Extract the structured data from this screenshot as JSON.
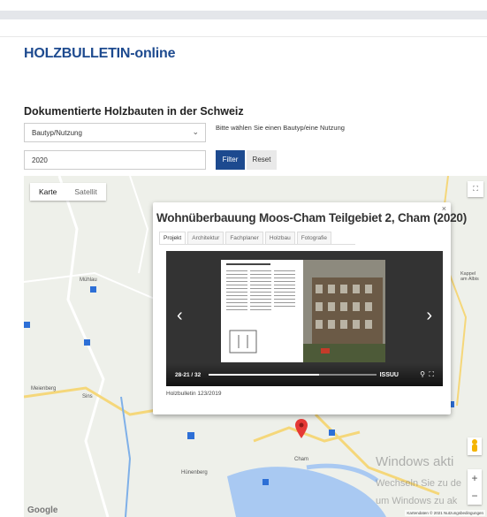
{
  "site": {
    "title": "HOLZBULLETIN-online"
  },
  "section": {
    "title": "Dokumentierte Holzbauten in der Schweiz"
  },
  "filters": {
    "type_select": {
      "value": "Bautyp/Nutzung"
    },
    "hint": "Bitte wählen Sie einen Bautyp/eine Nutzung",
    "year": {
      "value": "2020"
    },
    "filter_label": "Filter",
    "reset_label": "Reset"
  },
  "map": {
    "type_tabs": [
      {
        "label": "Karte",
        "active": true
      },
      {
        "label": "Satellit",
        "active": false
      }
    ],
    "places": [
      "Mühlau",
      "Meienberg",
      "Sins",
      "Hünenberg",
      "Cham",
      "Kappel am Albis"
    ],
    "google": "Google",
    "attribution": "Kartendaten © 2021  Nutzungsbedingungen",
    "colors": {
      "marker": "#e53935",
      "water": "#a9c9f2",
      "road": "#f5d77a",
      "poi": "#2d6fd6"
    }
  },
  "popup": {
    "title": "Wohnüberbauung Moos-Cham Teilgebiet 2, Cham (2020)",
    "tabs": [
      {
        "label": "Projekt",
        "active": true
      },
      {
        "label": "Architektur",
        "active": false
      },
      {
        "label": "Fachplaner",
        "active": false
      },
      {
        "label": "Holzbau",
        "active": false
      },
      {
        "label": "Fotografie",
        "active": false
      }
    ],
    "viewer": {
      "page_label": "28-21 / 32",
      "progress": 0.66,
      "brand": "ISSUU"
    },
    "caption": "Holzbulletin 123/2019"
  },
  "os_watermark": {
    "line1": "Windows akti",
    "line2": "Wechseln Sie zu de",
    "line3": "um Windows zu ak"
  }
}
